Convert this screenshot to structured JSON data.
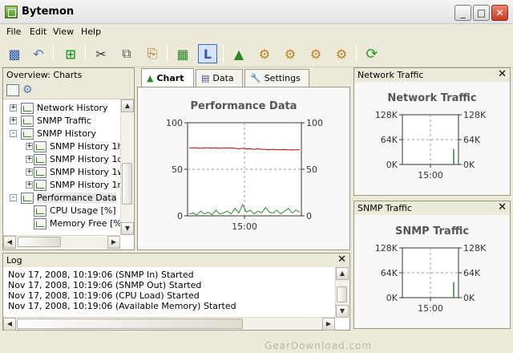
{
  "window": {
    "title": "Bytemon",
    "minimize": "_",
    "maximize": "□",
    "close": "✕"
  },
  "menu": [
    "File",
    "Edit",
    "View",
    "Help"
  ],
  "toolbar": {
    "icons": [
      "save-icon",
      "undo-icon",
      "add-icon",
      "cut-icon",
      "copy-icon",
      "paste-icon",
      "new-chart-icon",
      "layout-icon",
      "probe-1-icon",
      "probe-2-icon",
      "probe-3-icon",
      "probe-4-icon",
      "snmp-probe-icon",
      "refresh-icon"
    ]
  },
  "overview": {
    "title": "Overview: Charts",
    "tree": [
      {
        "label": "Network History",
        "level": 1,
        "expander": "+"
      },
      {
        "label": "SNMP Traffic",
        "level": 1,
        "expander": "+"
      },
      {
        "label": "SNMP History",
        "level": 1,
        "expander": "-"
      },
      {
        "label": "SNMP History 1h",
        "level": 2,
        "expander": "+"
      },
      {
        "label": "SNMP History 1d",
        "level": 2,
        "expander": "+"
      },
      {
        "label": "SNMP History 1w",
        "level": 2,
        "expander": "+"
      },
      {
        "label": "SNMP History 1m",
        "level": 2,
        "expander": "+"
      },
      {
        "label": "Performance Data",
        "level": 1,
        "expander": "-",
        "selected": true
      },
      {
        "label": "CPU Usage [%]",
        "level": 2,
        "expander": ""
      },
      {
        "label": "Memory Free [%",
        "level": 2,
        "expander": ""
      }
    ]
  },
  "tabs": [
    {
      "label": "Chart",
      "active": true
    },
    {
      "label": "Data",
      "active": false
    },
    {
      "label": "Settings",
      "active": false
    }
  ],
  "chart_data": [
    {
      "type": "line",
      "title": "Performance Data",
      "xlabel": "",
      "ylabel": "",
      "x_ticks": [
        "15:00"
      ],
      "y_ticks_left": [
        "100",
        "50",
        "0"
      ],
      "y_ticks_right": [
        "100",
        "50",
        "0"
      ],
      "ylim": [
        0,
        100
      ],
      "grid": true,
      "series": [
        {
          "color": "#c00000",
          "values": [
            73,
            73,
            73,
            72.5,
            73,
            73,
            72.8,
            73,
            72.5,
            73,
            72.8,
            73,
            72.5,
            72,
            72.5,
            72,
            72,
            71.5,
            72,
            71.5,
            71.5,
            71,
            71.5,
            71,
            71,
            71.2,
            70.8,
            71,
            70.8,
            71
          ]
        },
        {
          "color": "#2a8a2a",
          "values": [
            2,
            3,
            1,
            5,
            2,
            4,
            1,
            6,
            2,
            3,
            5,
            2,
            8,
            3,
            12,
            4,
            6,
            2,
            5,
            3,
            9,
            4,
            3,
            6,
            2,
            5,
            8,
            3,
            6,
            4
          ]
        }
      ]
    },
    {
      "type": "line",
      "title": "Network Traffic",
      "x_ticks": [
        "15:00"
      ],
      "y_ticks_left": [
        "128K",
        "64K",
        "0K"
      ],
      "y_ticks_right": [
        "128K",
        "64K",
        "0K"
      ],
      "ylim": [
        0,
        128
      ],
      "grid": true,
      "series": [
        {
          "color": "#2a8a2a",
          "spike_value": 40
        }
      ]
    },
    {
      "type": "line",
      "title": "SNMP Traffic",
      "x_ticks": [
        "15:00"
      ],
      "y_ticks_left": [
        "128K",
        "64K",
        "0K"
      ],
      "y_ticks_right": [
        "128K",
        "64K",
        "0K"
      ],
      "ylim": [
        0,
        128
      ],
      "grid": true,
      "series": [
        {
          "color": "#2a8a2a",
          "spike_value": 40
        }
      ]
    }
  ],
  "network_panel": {
    "title": "Network Traffic"
  },
  "snmp_panel": {
    "title": "SNMP Traffic"
  },
  "log": {
    "title": "Log",
    "lines": [
      "Nov 17, 2008, 10:19:06 (SNMP In) Started",
      "Nov 17, 2008, 10:19:06 (SNMP Out) Started",
      "Nov 17, 2008, 10:19:06 (CPU Load) Started",
      "Nov 17, 2008, 10:19:06 (Available Memory) Started"
    ]
  },
  "watermark": "GearDownload.com"
}
